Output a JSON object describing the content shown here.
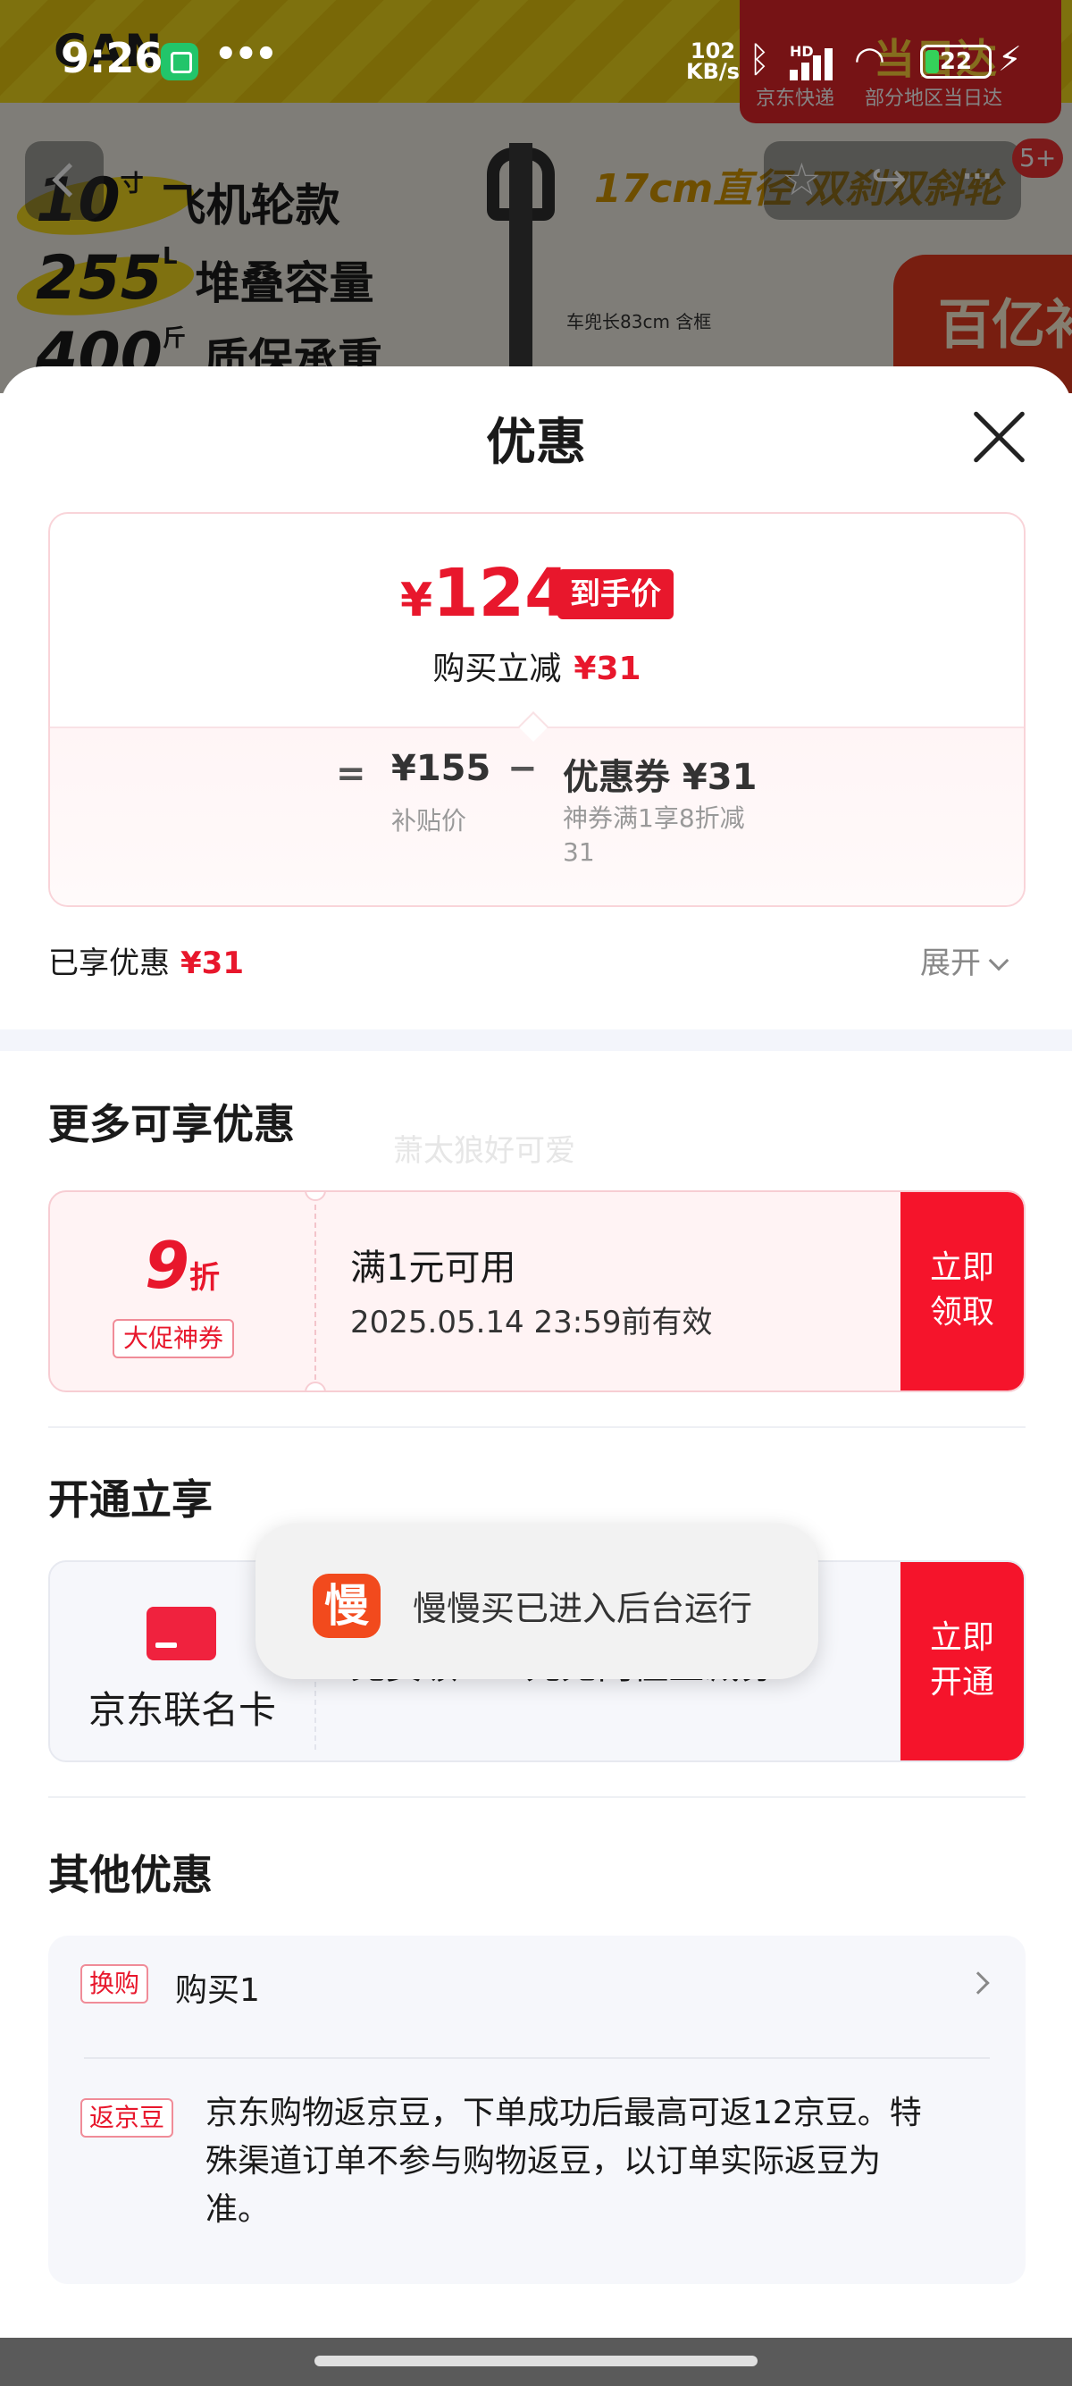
{
  "status_bar": {
    "time": "9:26",
    "net_speed_value": "102",
    "net_speed_unit": "KB/s",
    "signal_type": "HD",
    "battery_level": "22",
    "battery_fraction": 0.22
  },
  "background": {
    "brand_text": "CAN",
    "logistics_title": "当日达",
    "logistics_left": "京东快递",
    "logistics_right": "部分地区当日达",
    "features": [
      {
        "num": "10",
        "unit": "寸",
        "text": "飞机轮款"
      },
      {
        "num": "255",
        "unit": "L",
        "text": "堆叠容量"
      },
      {
        "num": "400",
        "unit": "斤",
        "text": "质保承重"
      }
    ],
    "headline": "17cm直径 双刹双斜轮",
    "dimension_label": "车兜长83cm 含框",
    "subsidy_badge": "百亿补贴",
    "message_count": "5+"
  },
  "sheet": {
    "title": "优惠",
    "price_card": {
      "currency": "¥",
      "final_price": "124",
      "final_badge": "到手价",
      "instant_label": "购买立减",
      "instant_amount": "¥31",
      "equals": "=",
      "base_price": "¥155",
      "base_label": "补贴价",
      "minus": "−",
      "coupon_line": "优惠券 ¥31",
      "coupon_desc": "神券满1享8折减31"
    },
    "enjoyed": {
      "label": "已享优惠",
      "amount": "¥31"
    },
    "expand_label": "展开",
    "more_section": {
      "title": "更多可享优惠",
      "watermark": "萧太狼好可爱",
      "coupon": {
        "discount_num": "9",
        "discount_unit": "折",
        "tag": "大促神券",
        "condition": "满1元可用",
        "validity": "2025.05.14 23:59前有效",
        "button_line1": "立即",
        "button_line2": "领取"
      }
    },
    "open_section": {
      "title": "开通立享",
      "card_name": "京东联名卡",
      "benefit": "免费领100元无门槛立减券",
      "button_line1": "立即",
      "button_line2": "开通"
    },
    "other_section": {
      "title": "其他优惠",
      "swap_tag": "换购",
      "swap_text": "购买1",
      "bean_tag": "返京豆",
      "bean_text": "京东购物返京豆，下单成功后最高可返12京豆。特殊渠道订单不参与购物返豆，以订单实际返豆为准。"
    }
  },
  "toast": {
    "icon_char": "慢",
    "text": "慢慢买已进入后台运行"
  }
}
